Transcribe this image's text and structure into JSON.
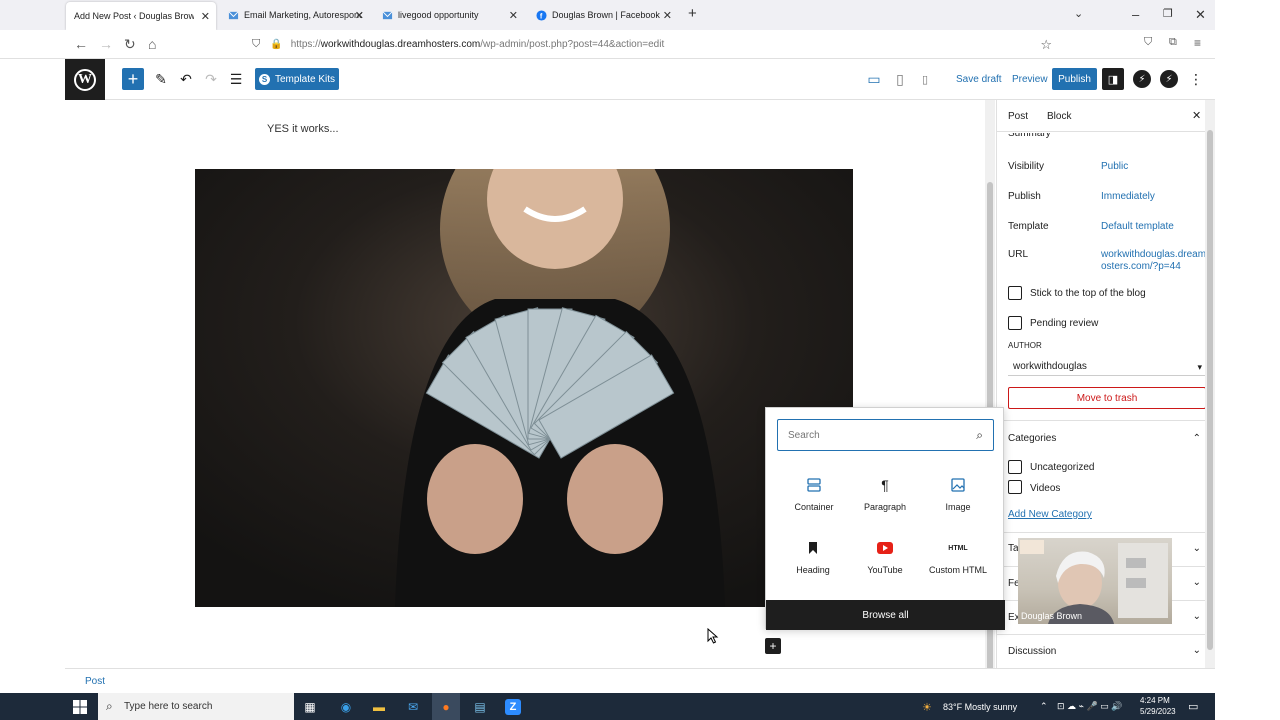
{
  "browser": {
    "tabs": [
      {
        "title": "Add New Post ‹ Douglas Brown — W",
        "active": true
      },
      {
        "title": "Email Marketing, Autoresponde",
        "active": false
      },
      {
        "title": "livegood opportunity",
        "active": false
      },
      {
        "title": "Douglas Brown | Facebook",
        "active": false
      }
    ],
    "url_prefix": "https://",
    "url_host": "workwithdouglas.dreamhosters.com",
    "url_path": "/wp-admin/post.php?post=44&action=edit"
  },
  "toolbar": {
    "template_kits_label": "Template Kits",
    "save_draft_label": "Save draft",
    "preview_label": "Preview",
    "publish_label": "Publish"
  },
  "content": {
    "paragraph": "YES it works..."
  },
  "sidebar": {
    "tab_post": "Post",
    "tab_block": "Block",
    "summary_label": "Summary",
    "visibility_label": "Visibility",
    "visibility_value": "Public",
    "publish_label": "Publish",
    "publish_value": "Immediately",
    "template_label": "Template",
    "template_value": "Default template",
    "url_label": "URL",
    "url_value_line1": "workwithdouglas.dreamh",
    "url_value_line2": "osters.com/?p=44",
    "sticky_label": "Stick to the top of the blog",
    "pending_label": "Pending review",
    "author_heading": "AUTHOR",
    "author_value": "workwithdouglas",
    "trash_label": "Move to trash",
    "categories_heading": "Categories",
    "category_1": "Uncategorized",
    "category_2": "Videos",
    "add_category": "Add New Category",
    "tags_partial": "Tag",
    "featured_partial": "Fea",
    "excerpt_partial": "Ex",
    "discussion_heading": "Discussion"
  },
  "inserter": {
    "search_placeholder": "Search",
    "blocks": [
      {
        "label": "Container",
        "icon": "container-icon"
      },
      {
        "label": "Paragraph",
        "icon": "paragraph-icon"
      },
      {
        "label": "Image",
        "icon": "image-icon"
      },
      {
        "label": "Heading",
        "icon": "heading-icon"
      },
      {
        "label": "YouTube",
        "icon": "youtube-icon"
      },
      {
        "label": "Custom HTML",
        "icon": "html-icon"
      }
    ],
    "browse_all_label": "Browse all"
  },
  "footer": {
    "breadcrumb": "Post"
  },
  "webcam": {
    "name": "Douglas Brown"
  },
  "taskbar": {
    "search_placeholder": "Type here to search",
    "weather": "83°F  Mostly sunny",
    "time": "4:24 PM",
    "date": "5/29/2023"
  },
  "colors": {
    "wp_blue": "#2271b1",
    "dark": "#1e1e1e",
    "trash_red": "#cc1818",
    "taskbar": "#1d2a3a"
  }
}
